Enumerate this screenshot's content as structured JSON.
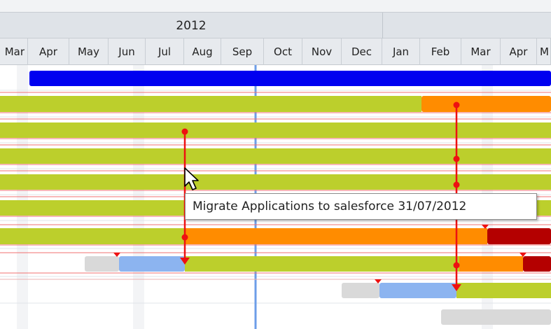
{
  "timeline": {
    "years": [
      {
        "label": "2012"
      },
      {
        "label": ""
      }
    ],
    "months": [
      "Mar",
      "Apr",
      "May",
      "Jun",
      "Jul",
      "Aug",
      "Sep",
      "Oct",
      "Nov",
      "Dec",
      "Jan",
      "Feb",
      "Mar",
      "Apr",
      "M"
    ]
  },
  "tooltip": {
    "text": "Migrate Applications to salesforce 31/07/2012"
  },
  "colors": {
    "summary_blue": "#0000f0",
    "task_green": "#bccf2c",
    "task_orange": "#ff8c00",
    "task_darkred": "#b40000",
    "task_lightblue": "#8cb4f0",
    "task_gray": "#d9d9d9",
    "dependency_red": "#ee1111",
    "today_line": "#6d9ee8"
  }
}
